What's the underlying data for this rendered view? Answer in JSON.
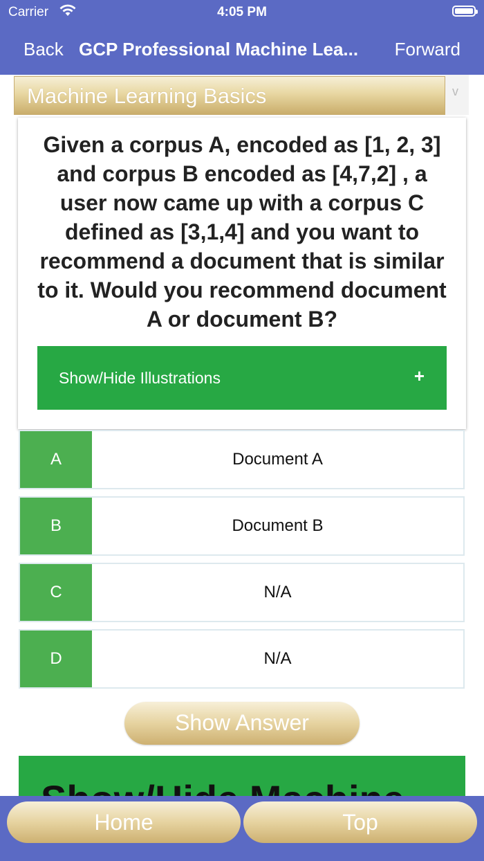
{
  "status_bar": {
    "carrier": "Carrier",
    "time": "4:05 PM"
  },
  "nav": {
    "back": "Back",
    "title": "GCP Professional Machine Lea...",
    "forward": "Forward"
  },
  "category": {
    "selected": "Machine Learning Basics",
    "arrow": "v"
  },
  "question": {
    "text": "Given a corpus A, encoded as [1, 2, 3] and corpus B encoded as [4,7,2] , a user now came up with a corpus C defined as [3,1,4] and you want to recommend a document that is similar to it. Would you recommend document A or document B?",
    "illustrations_label": "Show/Hide Illustrations",
    "illustrations_icon": "+"
  },
  "options": [
    {
      "letter": "A",
      "text": "Document A"
    },
    {
      "letter": "B",
      "text": "Document B"
    },
    {
      "letter": "C",
      "text": "N/A"
    },
    {
      "letter": "D",
      "text": "N/A"
    }
  ],
  "show_answer_label": "Show Answer",
  "ml_toggle_label": "Show/Hide Machine",
  "bottom": {
    "home": "Home",
    "top": "Top"
  },
  "colors": {
    "nav_bg": "#5b6ac4",
    "green": "#27a844",
    "option_green": "#4caf50",
    "gold": "#e6d3a0"
  }
}
